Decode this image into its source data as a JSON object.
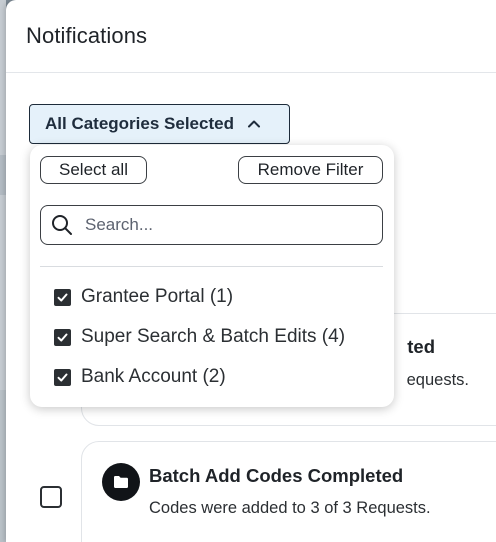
{
  "panel": {
    "title": "Notifications"
  },
  "filter": {
    "button_label": "All Categories Selected",
    "chevron_icon": "chevron-up-icon",
    "select_all_label": "Select all",
    "remove_filter_label": "Remove Filter",
    "search": {
      "placeholder": "Search...",
      "value": "",
      "icon": "search-icon"
    },
    "options": [
      {
        "label": "Grantee Portal (1)",
        "checked": true
      },
      {
        "label": "Super Search & Batch Edits (4)",
        "checked": true
      },
      {
        "label": "Bank Account (2)",
        "checked": true
      }
    ]
  },
  "notifications": [
    {
      "title_visible": "ted",
      "description_visible": "equests."
    },
    {
      "title": "Batch Add Codes Completed",
      "description": "Codes were added to 3 of 3 Requests.",
      "icon": "folder-icon",
      "selected": false
    }
  ],
  "colors": {
    "button_bg": "#e5f1fa",
    "icon_bg": "#111418",
    "backdrop": "#7d8a95"
  }
}
